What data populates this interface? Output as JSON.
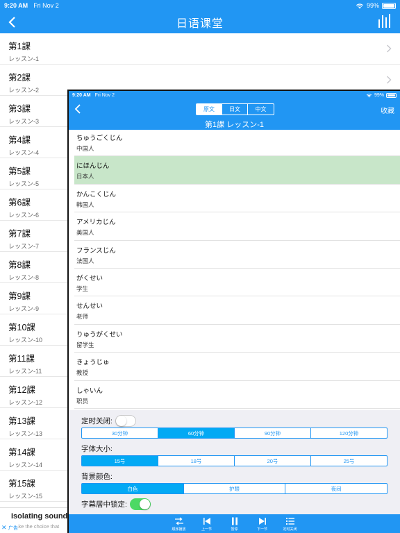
{
  "outer": {
    "status": {
      "time": "9:20 AM",
      "date": "Fri Nov 2",
      "battery": "99%"
    },
    "title": "日语课堂",
    "lessons": [
      {
        "title": "第1課",
        "subtitle": "レッスン-1"
      },
      {
        "title": "第2課",
        "subtitle": "レッスン-2"
      },
      {
        "title": "第3課",
        "subtitle": "レッスン-3"
      },
      {
        "title": "第4課",
        "subtitle": "レッスン-4"
      },
      {
        "title": "第5課",
        "subtitle": "レッスン-5"
      },
      {
        "title": "第6課",
        "subtitle": "レッスン-6"
      },
      {
        "title": "第7課",
        "subtitle": "レッスン-7"
      },
      {
        "title": "第8課",
        "subtitle": "レッスン-8"
      },
      {
        "title": "第9課",
        "subtitle": "レッスン-9"
      },
      {
        "title": "第10課",
        "subtitle": "レッスン-10"
      },
      {
        "title": "第11課",
        "subtitle": "レッスン-11"
      },
      {
        "title": "第12課",
        "subtitle": "レッスン-12"
      },
      {
        "title": "第13課",
        "subtitle": "レッスン-13"
      },
      {
        "title": "第14課",
        "subtitle": "レッスン-14"
      },
      {
        "title": "第15課",
        "subtitle": "レッスン-15"
      }
    ],
    "ad": {
      "title": "Isolating sound",
      "subtitle": "Make the choice that",
      "tag": "广告",
      "close": "✕"
    }
  },
  "player": {
    "status": {
      "time": "9:20 AM",
      "date": "Fri Nov 2",
      "battery": "99%"
    },
    "language_tabs": [
      "原文",
      "日文",
      "中文"
    ],
    "active_tab": "原文",
    "favorite": "收藏",
    "title": "第1課  レッスン-1",
    "words": [
      {
        "jp": "ちゅうごくじん",
        "cn": "中国人"
      },
      {
        "jp": "にほんじん",
        "cn": "日本人"
      },
      {
        "jp": "かんこくじん",
        "cn": "韩国人"
      },
      {
        "jp": "アメリカじん",
        "cn": "美国人"
      },
      {
        "jp": "フランスじん",
        "cn": "法国人"
      },
      {
        "jp": "がくせい",
        "cn": "学生"
      },
      {
        "jp": "せんせい",
        "cn": "老师"
      },
      {
        "jp": "りゅうがくせい",
        "cn": "留学生"
      },
      {
        "jp": "きょうじゅ",
        "cn": "教授"
      },
      {
        "jp": "しゃいん",
        "cn": "职员"
      }
    ],
    "highlighted_word": "にほんじん",
    "settings": {
      "timer_label": "定时关闭:",
      "timer_on": false,
      "timer_options": [
        "30分钟",
        "60分钟",
        "90分钟",
        "120分钟"
      ],
      "timer_selected": "60分钟",
      "font_label": "字体大小:",
      "font_options": [
        "15号",
        "18号",
        "20号",
        "25号"
      ],
      "font_selected": "15号",
      "bg_label": "背景颜色:",
      "bg_options": [
        "白色",
        "护眼",
        "夜间"
      ],
      "bg_selected": "白色",
      "lock_label": "字幕居中锁定:",
      "lock_on": true
    },
    "toolbar": [
      {
        "icon": "shuffle-icon",
        "label": "顺序播放"
      },
      {
        "icon": "previous-icon",
        "label": "上一节"
      },
      {
        "icon": "pause-icon",
        "label": "暂停"
      },
      {
        "icon": "next-icon",
        "label": "下一节"
      },
      {
        "icon": "list-icon",
        "label": "定时关闭"
      }
    ]
  },
  "colors": {
    "primary": "#2196F3",
    "highlight": "#C8E6C9",
    "toggle_on": "#4CD964",
    "segment_active": "#03A9F4"
  }
}
